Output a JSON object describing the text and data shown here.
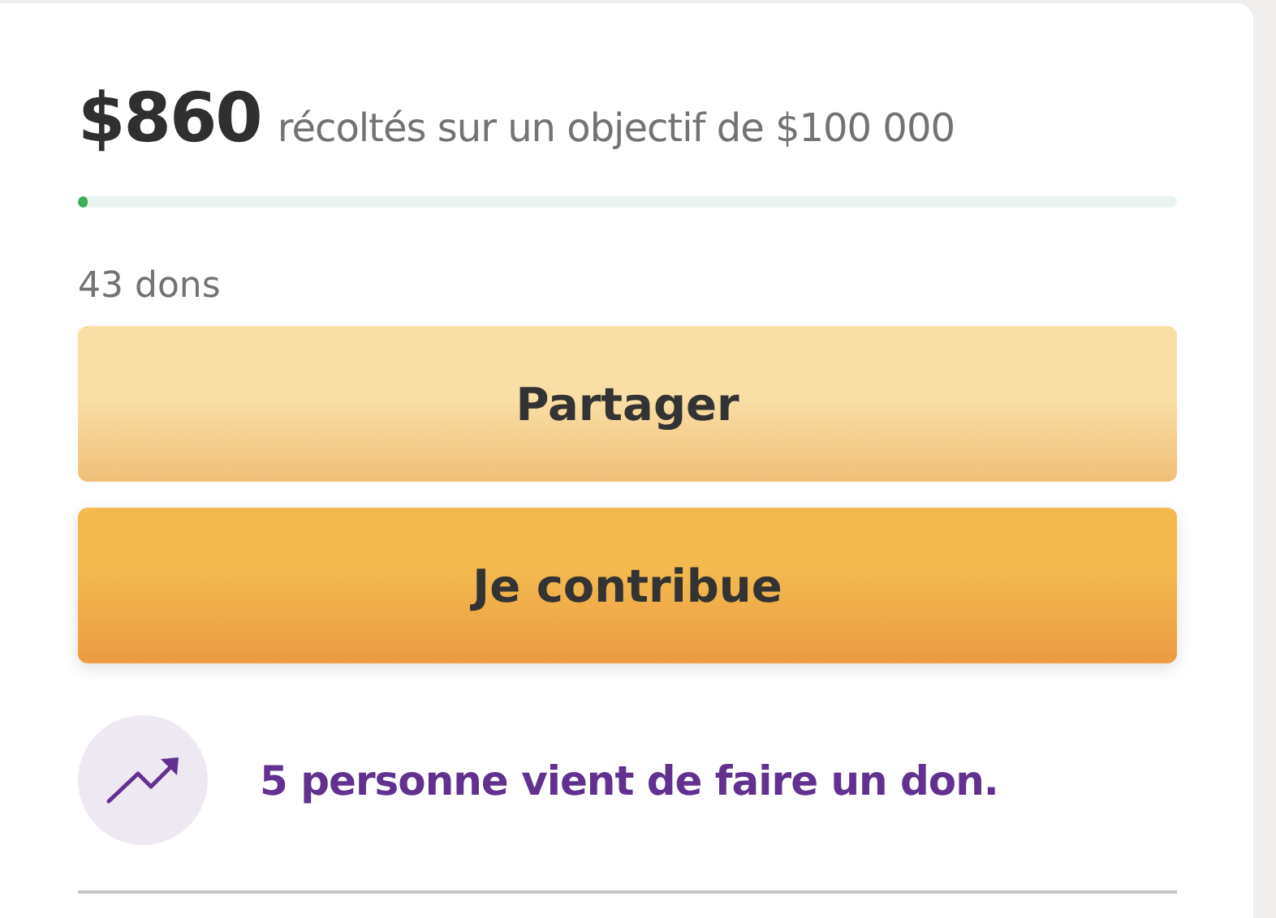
{
  "raised": {
    "amount": "$860",
    "goal_text": "récoltés sur un objectif de $100 000",
    "level": 0.0086
  },
  "donations_count": "43 dons",
  "buttons": [
    {
      "label": "Partager",
      "kind": "secondary"
    },
    {
      "label": "Je contribue",
      "kind": "primary"
    }
  ],
  "activity": {
    "message": "5 personne vient de faire un don."
  }
}
